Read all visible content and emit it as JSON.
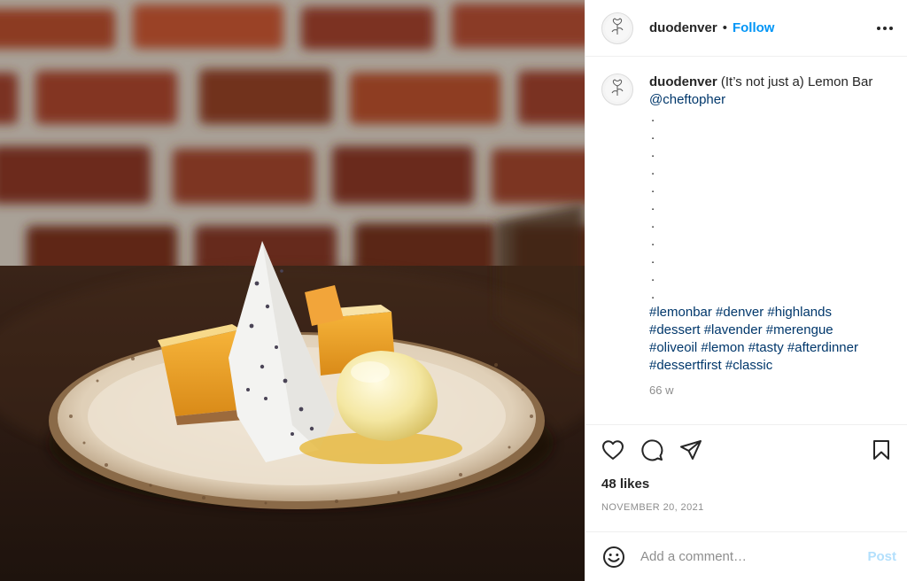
{
  "post": {
    "image_alt": "Lemon bar dessert with lavender meringue crisp and ice cream on a speckled ceramic plate",
    "author": {
      "username": "duodenver",
      "follow_label": "Follow",
      "separator": "•"
    },
    "caption": {
      "username": "duodenver",
      "text": "(It’s not just a) Lemon Bar",
      "mention": "@cheftopher",
      "dots": [
        ".",
        ".",
        ".",
        ".",
        ".",
        ".",
        ".",
        ".",
        ".",
        ".",
        "."
      ],
      "hashtags": "#lemonbar #denver #highlands #dessert #lavender #merengue #oliveoil #lemon #tasty #afterdinner #dessertfirst #classic",
      "time_ago": "66 w"
    },
    "actions": {
      "icons": [
        "heart-icon",
        "comment-icon",
        "share-icon",
        "bookmark-icon"
      ]
    },
    "likes_label": "48 likes",
    "date_label": "NOVEMBER 20, 2021",
    "comment": {
      "placeholder": "Add a comment…",
      "post_label": "Post"
    }
  },
  "colors": {
    "link": "#00376b",
    "accent": "#0095f6",
    "post_disabled": "#b2dffc",
    "muted": "#8e8e8e"
  }
}
